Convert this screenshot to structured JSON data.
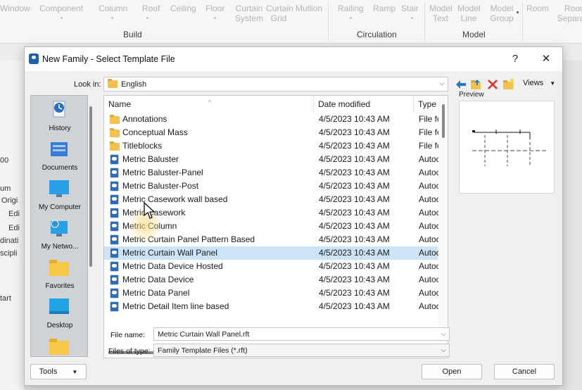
{
  "ribbon": {
    "items": [
      "Window",
      "Component",
      "Column",
      "Roof",
      "Ceiling",
      "Floor",
      "Curtain System",
      "Curtain Grid",
      "Mullion",
      "Railing",
      "Ramp",
      "Stair",
      "Model Text",
      "Model Line",
      "Model Group",
      "Room",
      "Room Separator"
    ],
    "groups": [
      "Build",
      "Circulation",
      "Model"
    ]
  },
  "background_left": [
    "00",
    "um",
    "Origi",
    "Edi",
    "Edi",
    "dinati",
    "scipli",
    "tart"
  ],
  "dialog": {
    "title": "New Family - Select Template File",
    "help_button": "?",
    "close_button": "✕",
    "look_in_label": "Look in:",
    "look_in_value": "English",
    "views_label": "Views",
    "preview_label": "Preview",
    "places": [
      {
        "label": "History",
        "icon": "history-icon"
      },
      {
        "label": "Documents",
        "icon": "documents-icon"
      },
      {
        "label": "My Computer",
        "icon": "computer-icon"
      },
      {
        "label": "My Netwo...",
        "icon": "network-icon"
      },
      {
        "label": "Favorites",
        "icon": "favorites-folder-icon"
      },
      {
        "label": "Desktop",
        "icon": "desktop-icon"
      },
      {
        "label": "",
        "icon": "folder-icon"
      }
    ],
    "columns": {
      "name": "Name",
      "date": "Date modified",
      "type": "Type"
    },
    "files": [
      {
        "name": "Annotations",
        "date": "4/5/2023 10:43 AM",
        "type": "File fo",
        "kind": "folder"
      },
      {
        "name": "Conceptual Mass",
        "date": "4/5/2023 10:43 AM",
        "type": "File fo",
        "kind": "folder"
      },
      {
        "name": "Titleblocks",
        "date": "4/5/2023 10:43 AM",
        "type": "File fo",
        "kind": "folder"
      },
      {
        "name": "Metric Baluster",
        "date": "4/5/2023 10:43 AM",
        "type": "Autoc",
        "kind": "rft"
      },
      {
        "name": "Metric Baluster-Panel",
        "date": "4/5/2023 10:43 AM",
        "type": "Autoc",
        "kind": "rft"
      },
      {
        "name": "Metric Baluster-Post",
        "date": "4/5/2023 10:43 AM",
        "type": "Autoc",
        "kind": "rft"
      },
      {
        "name": "Metric Casework wall based",
        "date": "4/5/2023 10:43 AM",
        "type": "Autoc",
        "kind": "rft"
      },
      {
        "name": "Metric Casework",
        "date": "4/5/2023 10:43 AM",
        "type": "Autoc",
        "kind": "rft"
      },
      {
        "name": "Metric Column",
        "date": "4/5/2023 10:43 AM",
        "type": "Autoc",
        "kind": "rft"
      },
      {
        "name": "Metric Curtain Panel Pattern Based",
        "date": "4/5/2023 10:43 AM",
        "type": "Autoc",
        "kind": "rft"
      },
      {
        "name": "Metric Curtain Wall Panel",
        "date": "4/5/2023 10:43 AM",
        "type": "Autoc",
        "kind": "rft",
        "selected": true
      },
      {
        "name": "Metric Data Device Hosted",
        "date": "4/5/2023 10:43 AM",
        "type": "Autoc",
        "kind": "rft"
      },
      {
        "name": "Metric Data Device",
        "date": "4/5/2023 10:43 AM",
        "type": "Autoc",
        "kind": "rft"
      },
      {
        "name": "Metric Data Panel",
        "date": "4/5/2023 10:43 AM",
        "type": "Autoc",
        "kind": "rft"
      },
      {
        "name": "Metric Detail Item line based",
        "date": "4/5/2023 10:43 AM",
        "type": "Autoc",
        "kind": "rft"
      }
    ],
    "file_name_label": "File name:",
    "file_name_value": "Metric Curtain Wall Panel.rft",
    "files_of_type_label": "Files of type:",
    "files_of_type_value": "Family Template Files  (*.rft)",
    "tools_label": "Tools",
    "open_label": "Open",
    "cancel_label": "Cancel"
  },
  "colors": {
    "selection": "#cce4f7",
    "folder": "#f2c14e",
    "accent": "#2d6cbc"
  }
}
